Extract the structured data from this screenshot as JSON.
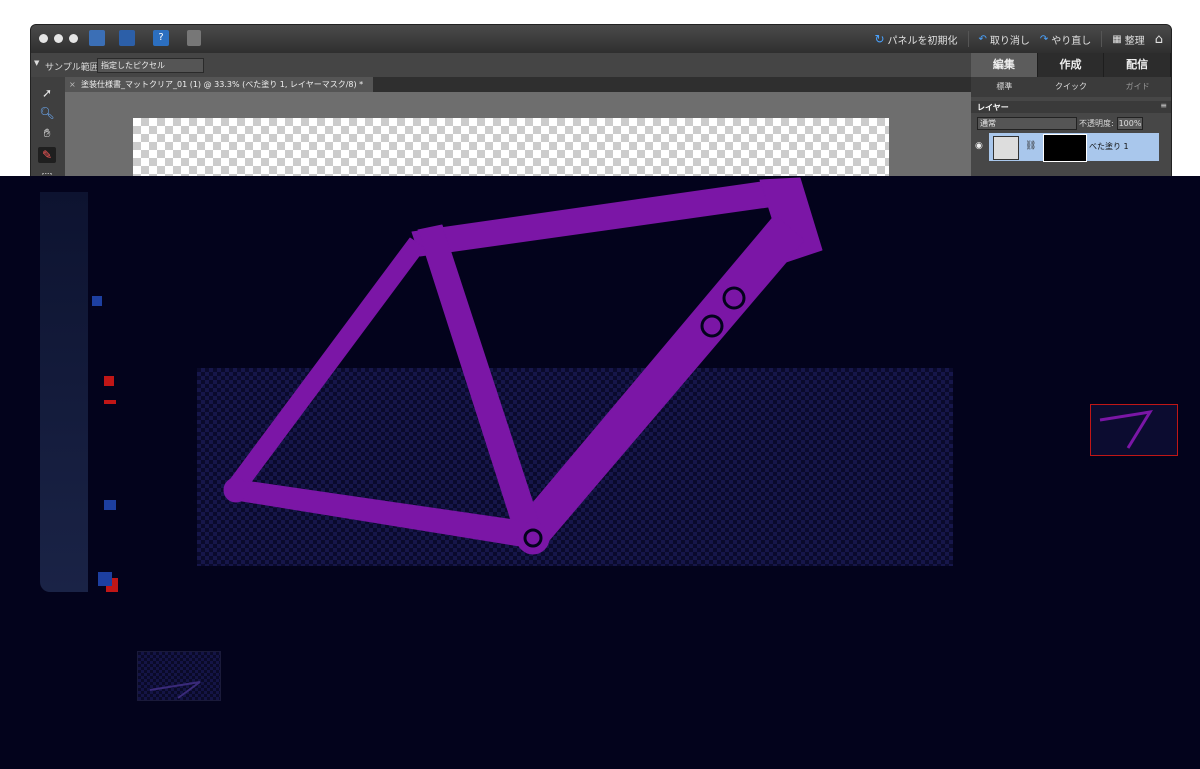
{
  "toolbar": {
    "reset_panels": "パネルを初期化",
    "undo": "取り消し",
    "redo": "やり直し",
    "organize": "整理"
  },
  "options": {
    "sample_label": "サンプル範囲:",
    "sample_value": "指定したピクセル"
  },
  "document": {
    "tab_title": "塗装仕様書_マットクリア_01 (1) @ 33.3% (べた塗り 1, レイヤーマスク/8) *"
  },
  "mode_tabs": [
    "編集",
    "作成",
    "配信"
  ],
  "sub_tabs": [
    "標準",
    "クイック",
    "ガイド"
  ],
  "layers_panel": {
    "title": "レイヤー",
    "blend_mode": "通常",
    "opacity_label": "不透明度:",
    "opacity_value": "100%",
    "layer_name": "べた塗り 1"
  },
  "colors": {
    "frame": "#7b16a6",
    "overlay": "#03031c",
    "selection_border": "#c01616"
  }
}
